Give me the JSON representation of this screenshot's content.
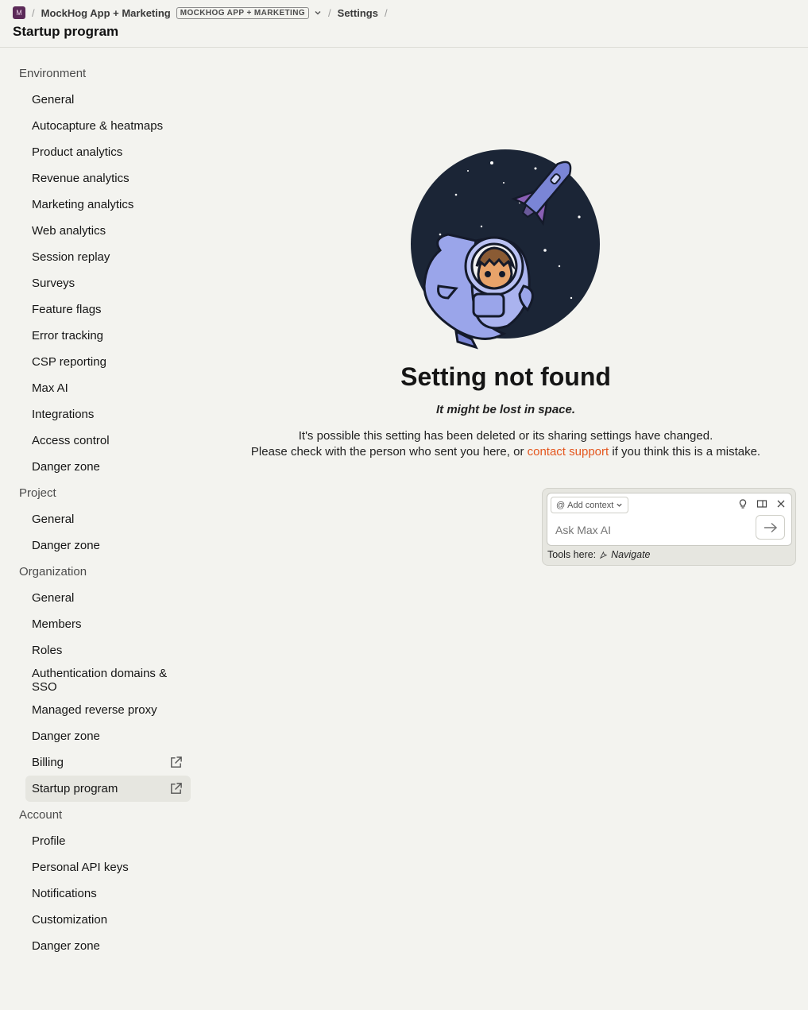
{
  "header": {
    "badge": "M",
    "project": "MockHog App + Marketing",
    "env_tag": "MOCKHOG APP + MARKETING",
    "crumb": "Settings",
    "title": "Startup program"
  },
  "sidebar": {
    "environment": {
      "title": "Environment",
      "items": [
        "General",
        "Autocapture & heatmaps",
        "Product analytics",
        "Revenue analytics",
        "Marketing analytics",
        "Web analytics",
        "Session replay",
        "Surveys",
        "Feature flags",
        "Error tracking",
        "CSP reporting",
        "Max AI",
        "Integrations",
        "Access control",
        "Danger zone"
      ]
    },
    "project": {
      "title": "Project",
      "items": [
        "General",
        "Danger zone"
      ]
    },
    "organization": {
      "title": "Organization",
      "items": [
        "General",
        "Members",
        "Roles",
        "Authentication domains & SSO",
        "Managed reverse proxy",
        "Danger zone",
        "Billing",
        "Startup program"
      ]
    },
    "account": {
      "title": "Account",
      "items": [
        "Profile",
        "Personal API keys",
        "Notifications",
        "Customization",
        "Danger zone"
      ]
    }
  },
  "main": {
    "title": "Setting not found",
    "subtitle": "It might be lost in space.",
    "line1": "It's possible this setting has been deleted or its sharing settings have changed.",
    "line2_pre": "Please check with the person who sent you here, or",
    "link": "contact support",
    "line2_post": "if you think this is a mistake."
  },
  "max": {
    "context_label": "Add context",
    "placeholder": "Ask Max AI",
    "tools_label": "Tools here:",
    "tool_name": "Navigate"
  },
  "colors": {
    "accent": "#e4571f",
    "badge": "#5b2a58",
    "background": "#f3f3ef"
  }
}
